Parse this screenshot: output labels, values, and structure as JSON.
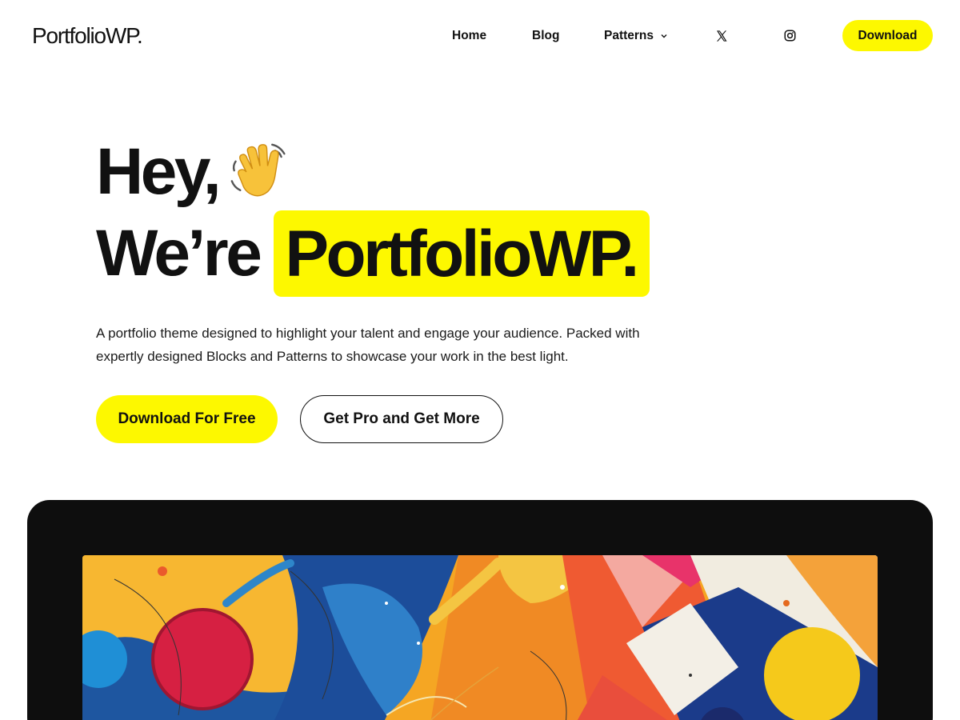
{
  "header": {
    "logo": "PortfolioWP.",
    "nav": {
      "home": "Home",
      "blog": "Blog",
      "patterns": "Patterns",
      "download": "Download"
    },
    "icons": [
      "x-twitter-icon",
      "instagram-icon",
      "chevron-down-icon"
    ]
  },
  "hero": {
    "greeting": "Hey,",
    "greeting_icon": "waving-hand-icon",
    "line2_prefix": "We’re",
    "line2_highlight": "PortfolioWP.",
    "description": "A portfolio theme designed to highlight your talent and engage your audience. Packed with expertly designed Blocks and Patterns to showcase your work in the best light.",
    "primary_cta": "Download For Free",
    "secondary_cta": "Get Pro and Get More"
  },
  "colors": {
    "accent": "#fdf800",
    "text": "#111111",
    "showcase_bg": "#0e0e0e"
  }
}
